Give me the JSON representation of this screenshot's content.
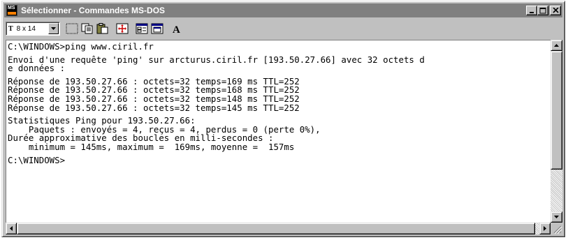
{
  "window": {
    "title": "Sélectionner - Commandes MS-DOS"
  },
  "toolbar": {
    "font_prefix": "T",
    "font_size": "8 x 14",
    "tools": [
      "mark-icon",
      "copy-icon",
      "paste-icon",
      "fullscreen-icon",
      "properties-icon",
      "background-icon",
      "font-icon"
    ],
    "font_button_label": "A"
  },
  "console": {
    "lines": [
      "C:\\WINDOWS>ping www.ciril.fr",
      "",
      "Envoi d'une requête 'ping' sur arcturus.ciril.fr [193.50.27.66] avec 32 octets d",
      "e données :",
      "",
      "Réponse de 193.50.27.66 : octets=32 temps=169 ms TTL=252",
      "Réponse de 193.50.27.66 : octets=32 temps=168 ms TTL=252",
      "Réponse de 193.50.27.66 : octets=32 temps=148 ms TTL=252",
      "Réponse de 193.50.27.66 : octets=32 temps=145 ms TTL=252",
      "",
      "Statistiques Ping pour 193.50.27.66:",
      "    Paquets : envoyés = 4, reçus = 4, perdus = 0 (perte 0%),",
      "Durée approximative des boucles en milli-secondes :",
      "    minimum = 145ms, maximum =  169ms, moyenne =  157ms",
      "",
      "C:\\WINDOWS>"
    ]
  },
  "colors": {
    "titlebar_inactive": "#808080",
    "face": "#c0c0c0",
    "console_bg": "#ffffff",
    "console_text": "#000000"
  }
}
